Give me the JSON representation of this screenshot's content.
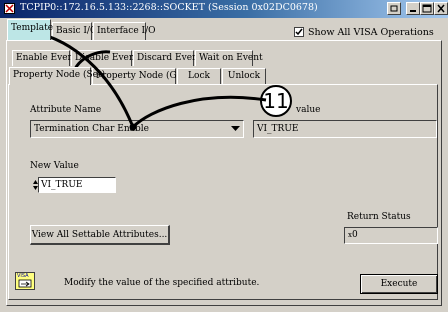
{
  "window": {
    "title": "TCPIP0::172.16.5.133::2268::SOCKET (Session 0x02DC0678)"
  },
  "main_tabs": [
    {
      "label": "Template",
      "active": true
    },
    {
      "label": "Basic I/O",
      "active": false
    },
    {
      "label": "Interface I/O",
      "active": false
    }
  ],
  "show_all_visa": {
    "label": "Show All VISA Operations",
    "checked": true
  },
  "sub_tabs_row1": [
    {
      "label": "Enable Event"
    },
    {
      "label": "Disable Event"
    },
    {
      "label": "Discard Events"
    },
    {
      "label": "Wait on Event"
    }
  ],
  "sub_tabs_row2": [
    {
      "label": "Property Node (Set)",
      "active": true
    },
    {
      "label": "Property Node (Get)",
      "active": false
    },
    {
      "label": "Lock",
      "active": false
    },
    {
      "label": "Unlock",
      "active": false
    }
  ],
  "form": {
    "attribute_name_label": "Attribute Name",
    "attribute_name_value": "Termination Char Enable",
    "current_value_label_visible": "value",
    "current_value": "VI_TRUE",
    "new_value_label": "New Value",
    "new_value": "VI_TRUE",
    "return_status_label": "Return Status",
    "return_status_value": "0",
    "return_status_prefix": "x"
  },
  "buttons": {
    "view_all_label": "View All Settable Attributes...",
    "execute_label": "Execute"
  },
  "description": {
    "icon_label": "VISA",
    "text": "Modify the value of the specified attribute."
  },
  "callout": {
    "number": "11"
  },
  "colors": {
    "title_start": "#0a246a",
    "title_end": "#a6caf0",
    "active_tab": "#bde6e6",
    "face": "#d4d0c8"
  }
}
